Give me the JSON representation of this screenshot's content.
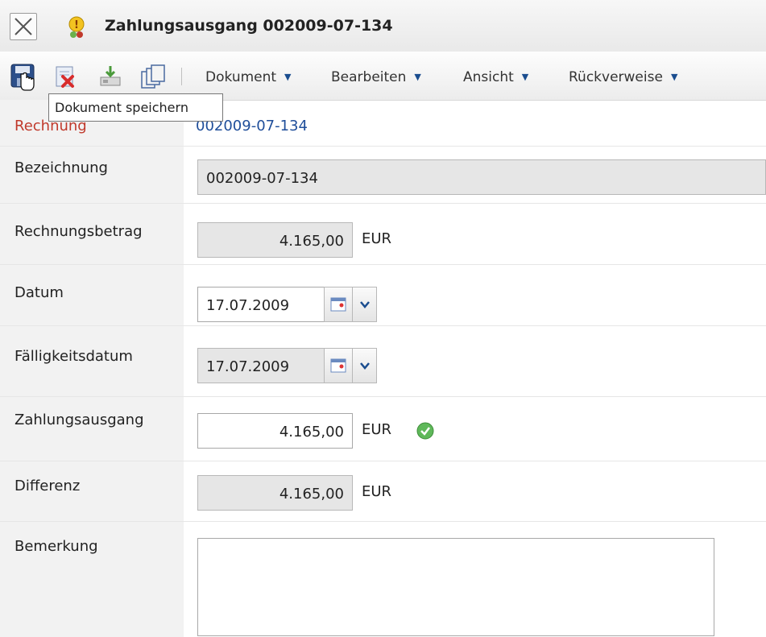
{
  "window": {
    "title": "Zahlungsausgang 002009-07-134"
  },
  "toolbar": {
    "icons": [
      "save-icon",
      "delete-icon",
      "export-icon",
      "copy-icon"
    ],
    "menus": [
      {
        "label": "Dokument"
      },
      {
        "label": "Bearbeiten"
      },
      {
        "label": "Ansicht"
      },
      {
        "label": "Rückverweise"
      }
    ],
    "tooltip": "Dokument speichern"
  },
  "form": {
    "rechnung": {
      "label": "Rechnung",
      "value": "002009-07-134"
    },
    "bezeichnung": {
      "label": "Bezeichnung",
      "value": "002009-07-134"
    },
    "rechnungsbetrag": {
      "label": "Rechnungsbetrag",
      "value": "4.165,00",
      "unit": "EUR"
    },
    "datum": {
      "label": "Datum",
      "value": "17.07.2009"
    },
    "faelligkeitsdatum": {
      "label": "Fälligkeitsdatum",
      "value": "17.07.2009"
    },
    "zahlungsausgang": {
      "label": "Zahlungsausgang",
      "value": "4.165,00",
      "unit": "EUR"
    },
    "differenz": {
      "label": "Differenz",
      "value": "4.165,00",
      "unit": "EUR"
    },
    "bemerkung": {
      "label": "Bemerkung",
      "value": ""
    }
  },
  "colors": {
    "accent_link": "#1f4e9a",
    "label_required": "#c0392b",
    "valid_check": "#4caf50"
  }
}
